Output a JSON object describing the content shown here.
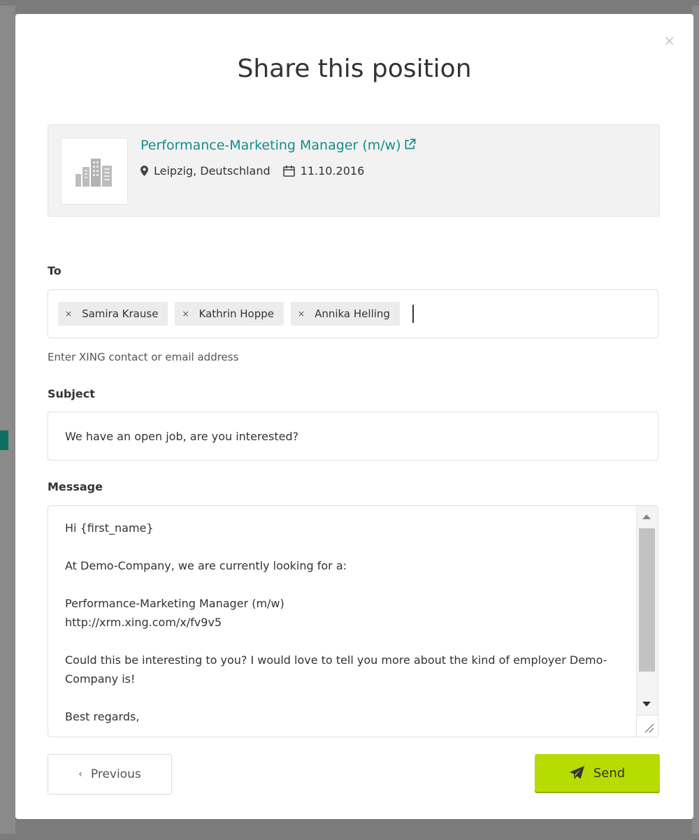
{
  "modal": {
    "title": "Share this position",
    "close_icon": "×"
  },
  "job": {
    "title": "Performance-Marketing Manager (m/w)",
    "location": "Leipzig, Deutschland",
    "date": "11.10.2016",
    "link_color": "#168c8a"
  },
  "to": {
    "label": "To",
    "recipients": [
      "Samira Krause",
      "Kathrin Hoppe",
      "Annika Helling"
    ],
    "remove_glyph": "×",
    "hint": "Enter XING contact or email address"
  },
  "subject": {
    "label": "Subject",
    "value": "We have an open job, are you interested?"
  },
  "message": {
    "label": "Message",
    "value": "Hi {first_name}\n\nAt Demo-Company, we are currently looking for a:\n\nPerformance-Marketing Manager (m/w)\nhttp://xrm.xing.com/x/fv9v5\n\nCould this be interesting to you? I would love to tell you more about the kind of employer Demo-Company is!\n\nBest regards,"
  },
  "buttons": {
    "previous_glyph": "‹",
    "previous_label": "Previous",
    "send_label": "Send",
    "send_color": "#b7dc00"
  }
}
